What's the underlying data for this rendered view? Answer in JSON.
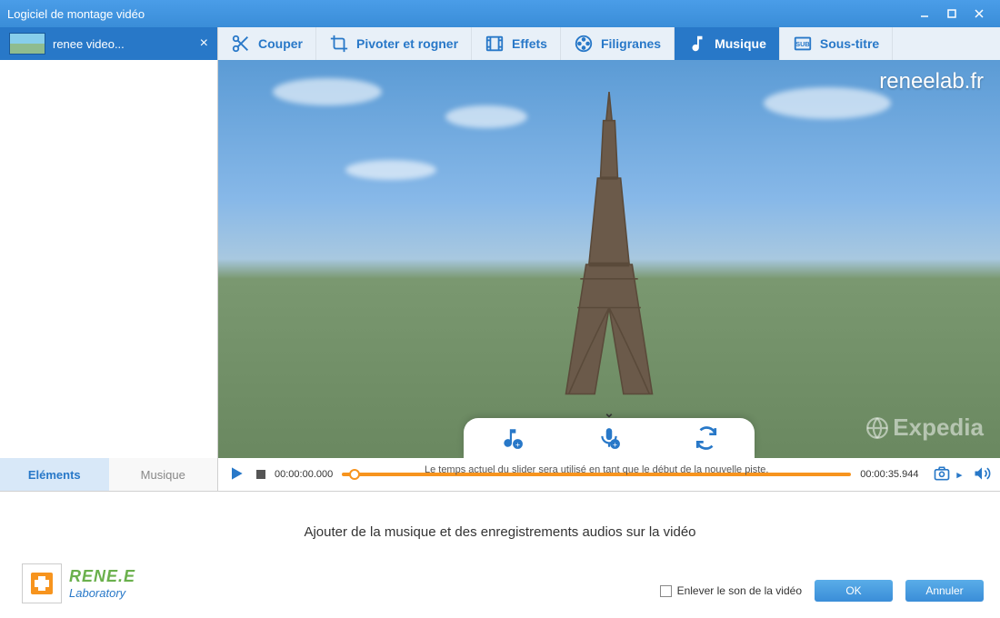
{
  "window": {
    "title": "Logiciel de montage vidéo"
  },
  "file": {
    "name": "renee video..."
  },
  "toolbar": {
    "cut": "Couper",
    "rotate": "Pivoter et rogner",
    "effects": "Effets",
    "watermark": "Filigranes",
    "music": "Musique",
    "subtitle": "Sous-titre"
  },
  "preview": {
    "watermark_top": "reneelab.fr",
    "watermark_bottom": "Expedia"
  },
  "timeline": {
    "current": "00:00:00.000",
    "caption": "Le temps actuel du slider sera utilisé en tant que le début de la nouvelle piste.",
    "total": "00:00:35.944"
  },
  "sidebar_tabs": {
    "elements": "Eléments",
    "music": "Musique"
  },
  "bottom": {
    "message": "Ajouter de la musique et des enregistrements audios sur la vidéo",
    "checkbox": "Enlever le son de la vidéo",
    "ok": "OK",
    "cancel": "Annuler",
    "brand": "RENE.E",
    "sub": "Laboratory"
  }
}
